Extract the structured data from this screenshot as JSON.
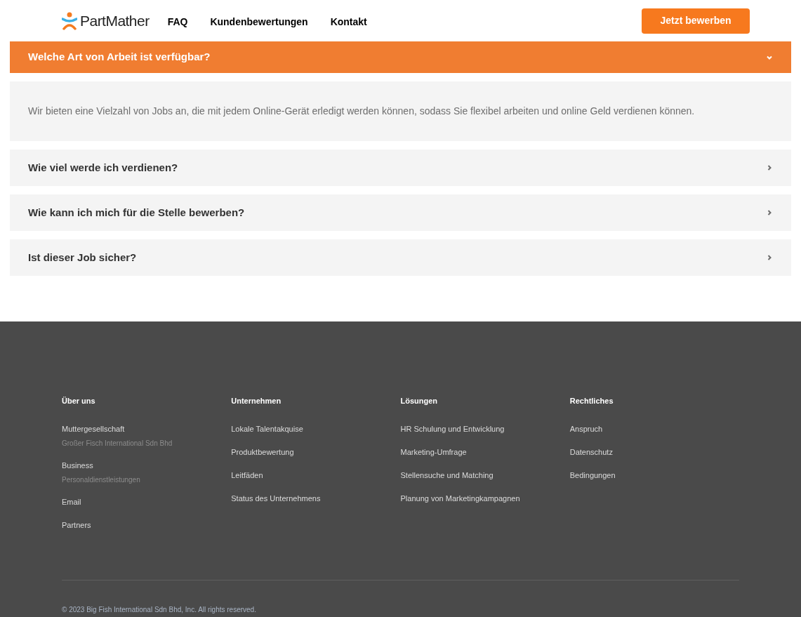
{
  "header": {
    "logo": "PartMather",
    "nav": [
      "FAQ",
      "Kundenbewertungen",
      "Kontakt"
    ],
    "cta": "Jetzt bewerben"
  },
  "faq": [
    {
      "question": "Welche Art von Arbeit ist verfügbar?",
      "expanded": true,
      "answer": "Wir bieten eine Vielzahl von Jobs an, die mit jedem Online-Gerät erledigt werden können, sodass Sie flexibel arbeiten und online Geld verdienen können."
    },
    {
      "question": "Wie viel werde ich verdienen?",
      "expanded": false
    },
    {
      "question": "Wie kann ich mich für die Stelle bewerben?",
      "expanded": false
    },
    {
      "question": "Ist dieser Job sicher?",
      "expanded": false
    }
  ],
  "footer": {
    "columns": [
      {
        "title": "Über uns",
        "links": [
          {
            "label": "Muttergesellschaft",
            "note": "Großer Fisch International Sdn Bhd"
          },
          {
            "label": "Business",
            "note": "Personaldienstleistungen"
          },
          {
            "label": "Email"
          },
          {
            "label": "Partners"
          }
        ]
      },
      {
        "title": "Unternehmen",
        "links": [
          {
            "label": "Lokale Talentakquise"
          },
          {
            "label": "Produktbewertung"
          },
          {
            "label": "Leitfäden"
          },
          {
            "label": "Status des Unternehmens"
          }
        ]
      },
      {
        "title": "Lösungen",
        "links": [
          {
            "label": "HR Schulung und Entwicklung"
          },
          {
            "label": "Marketing-Umfrage"
          },
          {
            "label": "Stellensuche und Matching"
          },
          {
            "label": "Planung von Marketingkampagnen"
          }
        ]
      },
      {
        "title": "Rechtliches",
        "links": [
          {
            "label": "Anspruch"
          },
          {
            "label": "Datenschutz"
          },
          {
            "label": "Bedingungen"
          }
        ]
      }
    ],
    "copyright": "© 2023 Big Fish International Sdn Bhd, Inc. All rights reserved."
  }
}
